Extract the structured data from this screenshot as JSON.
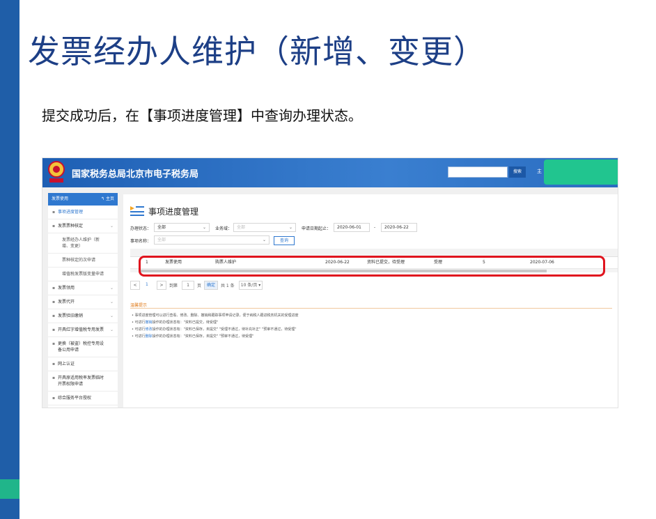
{
  "slide": {
    "title": "发票经办人维护（新增、变更）",
    "instruction": "提交成功后，在【事项进度管理】中查询办理状态。",
    "accent_colors": {
      "left_bar": "#1f5ea8",
      "accent_square": "#20b58a",
      "highlight_oval": "#e0141e"
    }
  },
  "screenshot": {
    "header": {
      "title": "国家税务总局北京市电子税务局",
      "search_button": "搜索",
      "link": "主"
    },
    "sidebar": {
      "head": "发票使用",
      "home": "主页",
      "items": [
        {
          "label": "事项进度管理",
          "active": true,
          "sub": false,
          "chevron": false
        },
        {
          "label": "发票票种核定",
          "active": false,
          "sub": false,
          "chevron": true
        },
        {
          "label": "发票经办人维护（新增、变更）",
          "active": false,
          "sub": true,
          "chevron": false
        },
        {
          "label": "票种核定的次申请",
          "active": false,
          "sub": true,
          "chevron": false
        },
        {
          "label": "增值税发票版变量申请",
          "active": false,
          "sub": true,
          "chevron": false
        },
        {
          "label": "发票领用",
          "active": false,
          "sub": false,
          "chevron": true
        },
        {
          "label": "发票代开",
          "active": false,
          "sub": false,
          "chevron": true
        },
        {
          "label": "发票验旧缴销",
          "active": false,
          "sub": false,
          "chevron": true
        },
        {
          "label": "开具红字增值税专用发票",
          "active": false,
          "sub": false,
          "chevron": true
        },
        {
          "label": "更换（被盗）税控专用设备公用申请",
          "active": false,
          "sub": false,
          "chevron": false
        },
        {
          "label": "网上认证",
          "active": false,
          "sub": false,
          "chevron": false
        },
        {
          "label": "开具原适用税率发票临时开票权限申请",
          "active": false,
          "sub": false,
          "chevron": false
        },
        {
          "label": "综合服务平台授权",
          "active": false,
          "sub": false,
          "chevron": false
        }
      ]
    },
    "main": {
      "title": "事项进度管理",
      "filters": {
        "status_label": "办理状态：",
        "status_value": "全部",
        "domain_label": "业务域：",
        "domain_value": "全部",
        "date_label": "申请日期起止：",
        "date_from": "2020-06-01",
        "date_sep": "-",
        "date_to": "2020-06-22",
        "name_label": "事项名称：",
        "name_value": "全部",
        "query_button": "查询"
      },
      "table": {
        "row": [
          "1",
          "发票使用",
          "购票人维护",
          "2020-06-22",
          "资料已提交，待受理",
          "受理",
          "5",
          "2020-07-06"
        ]
      },
      "pager": {
        "prev": "<",
        "current": "1",
        "next": ">",
        "goto_label": "到第",
        "goto_value": "1",
        "page_unit": "页",
        "confirm": "确定",
        "total": "共 1 条",
        "page_size": "10 条/页"
      },
      "tips": {
        "title": "温馨提示",
        "lines": [
          {
            "pre": "• 事项进度管理可以进行查看、修改、删除、撤销和跟踪事项申请记录，便于纳税人跟进税务机关的受理进度",
            "hl": "",
            "post": ""
          },
          {
            "pre": "• 可进行",
            "hl": "撤销",
            "post": "操作的办理状态有：\"资料已提交，待受理\""
          },
          {
            "pre": "• 可进行",
            "hl": "修改",
            "post": "操作的办理状态有：\"资料已保存，未提交\"   \"受理不通过，待补充补正\"   \"预审不通过，待受理\""
          },
          {
            "pre": "• 可进行",
            "hl": "删除",
            "post": "操作的办理状态有：\"资料已保存，未提交\"   \"预审不通过，待受理\""
          }
        ]
      }
    }
  }
}
